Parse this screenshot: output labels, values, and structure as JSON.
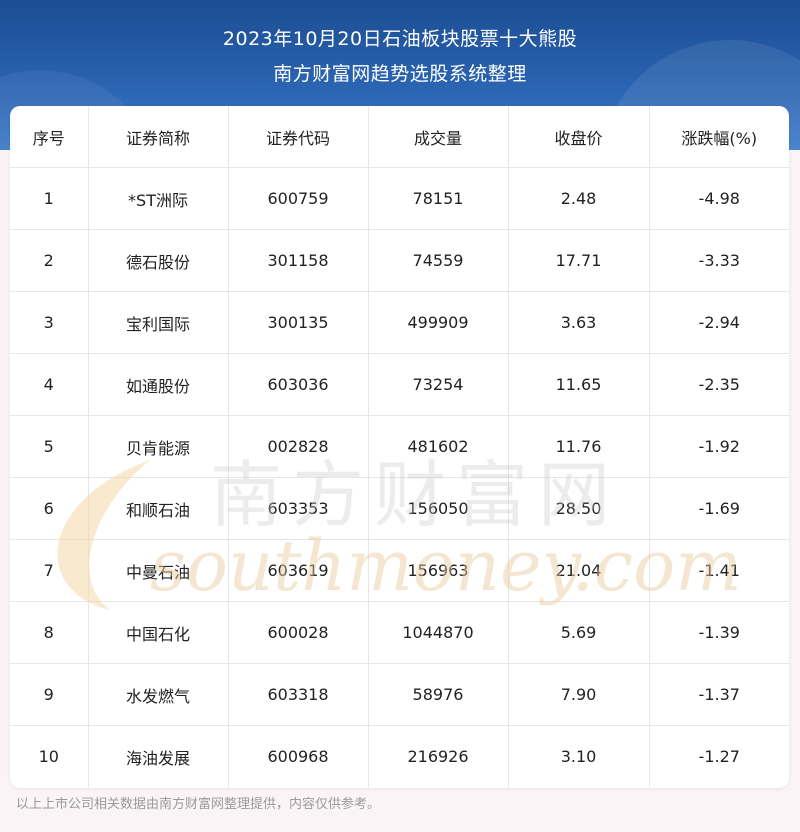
{
  "header": {
    "title_line1": "2023年10月20日石油板块股票十大熊股",
    "title_line2": "南方财富网趋势选股系统整理"
  },
  "table": {
    "columns": [
      "序号",
      "证券简称",
      "证券代码",
      "成交量",
      "收盘价",
      "涨跌幅(%)"
    ],
    "rows": [
      [
        "1",
        "*ST洲际",
        "600759",
        "78151",
        "2.48",
        "-4.98"
      ],
      [
        "2",
        "德石股份",
        "301158",
        "74559",
        "17.71",
        "-3.33"
      ],
      [
        "3",
        "宝利国际",
        "300135",
        "499909",
        "3.63",
        "-2.94"
      ],
      [
        "4",
        "如通股份",
        "603036",
        "73254",
        "11.65",
        "-2.35"
      ],
      [
        "5",
        "贝肯能源",
        "002828",
        "481602",
        "11.76",
        "-1.92"
      ],
      [
        "6",
        "和顺石油",
        "603353",
        "156050",
        "28.50",
        "-1.69"
      ],
      [
        "7",
        "中曼石油",
        "603619",
        "156963",
        "21.04",
        "-1.41"
      ],
      [
        "8",
        "中国石化",
        "600028",
        "1044870",
        "5.69",
        "-1.39"
      ],
      [
        "9",
        "水发燃气",
        "603318",
        "58976",
        "7.90",
        "-1.37"
      ],
      [
        "10",
        "海油发展",
        "600968",
        "216926",
        "3.10",
        "-1.27"
      ]
    ]
  },
  "watermark": {
    "cn": "南方财富网",
    "en": "southmoney.com"
  },
  "footer": {
    "note": "以上上市公司相关数据由南方财富网整理提供，内容仅供参考。"
  },
  "colors": {
    "header_blue": "#2a63b0",
    "border": "#e6e6e6",
    "text": "#222222",
    "footer_text": "#9a9a9a"
  }
}
